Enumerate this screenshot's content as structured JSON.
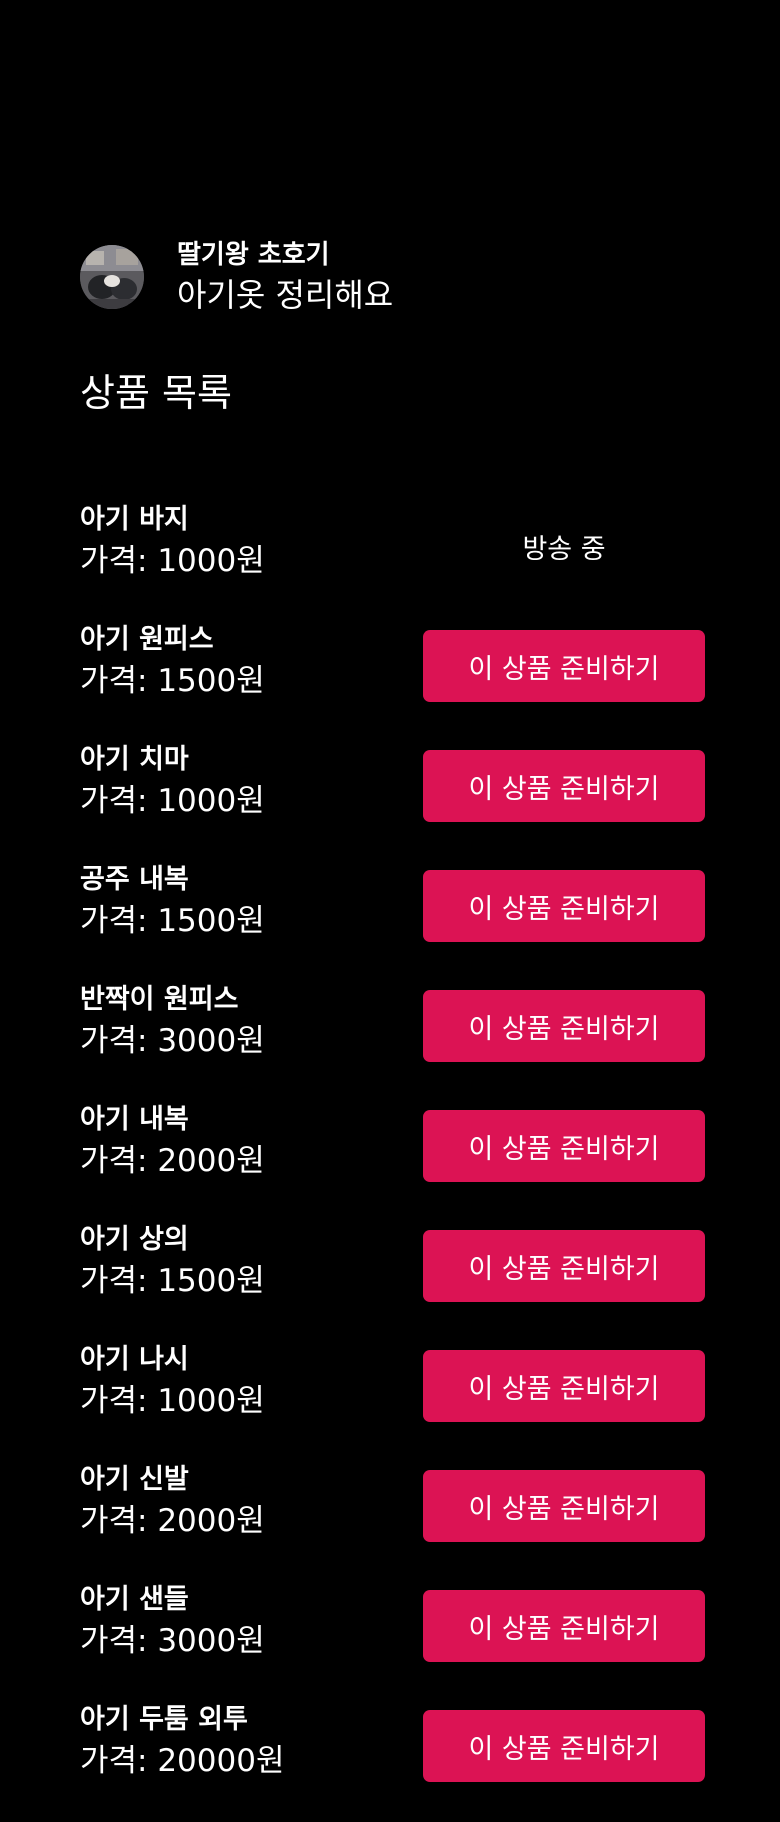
{
  "profile": {
    "seller_name": "딸기왕 초호기",
    "broadcast_title": "아기옷 정리해요"
  },
  "section_title": "상품 목록",
  "products": [
    {
      "name": "아기 바지",
      "price": "가격: 1000원",
      "status": "방송 중"
    },
    {
      "name": "아기 원피스",
      "price": "가격: 1500원",
      "button": "이 상품 준비하기"
    },
    {
      "name": "아기 치마",
      "price": "가격: 1000원",
      "button": "이 상품 준비하기"
    },
    {
      "name": "공주 내복",
      "price": "가격: 1500원",
      "button": "이 상품 준비하기"
    },
    {
      "name": "반짝이 원피스",
      "price": "가격: 3000원",
      "button": "이 상품 준비하기"
    },
    {
      "name": "아기 내복",
      "price": "가격: 2000원",
      "button": "이 상품 준비하기"
    },
    {
      "name": "아기 상의",
      "price": "가격: 1500원",
      "button": "이 상품 준비하기"
    },
    {
      "name": "아기 나시",
      "price": "가격: 1000원",
      "button": "이 상품 준비하기"
    },
    {
      "name": "아기 신발",
      "price": "가격: 2000원",
      "button": "이 상품 준비하기"
    },
    {
      "name": "아기 샌들",
      "price": "가격: 3000원",
      "button": "이 상품 준비하기"
    },
    {
      "name": "아기 두툼 외투",
      "price": "가격: 20000원",
      "button": "이 상품 준비하기"
    }
  ],
  "colors": {
    "background": "#000000",
    "accent": "#dc1354",
    "text": "#ffffff"
  }
}
